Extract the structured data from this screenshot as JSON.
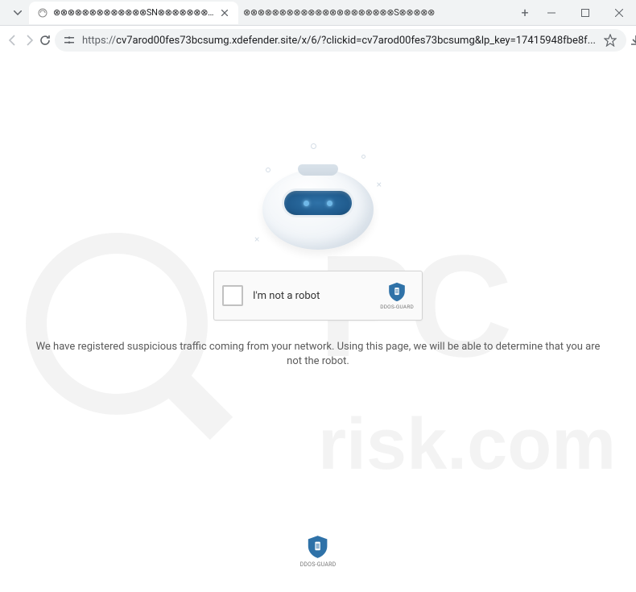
{
  "window": {
    "tab_title": "⊗⊗⊗⊗⊗⊗⊗⊗⊗⊗⊗⊗⊗SN⊗⊗⊗⊗⊗⊗⊗⊗⊗⊗⊗⊗⊗",
    "tab_extra": "⊗⊗⊗⊗⊗⊗⊗⊗⊗⊗⊗⊗⊗⊗⊗⊗⊗⊗⊗⊗⊗S⊗⊗⊗⊗⊗",
    "url_protocol": "https://",
    "url": "cv7arod00fes73bcsumg.xdefender.site/x/6/?clickid=cv7arod00fes73bcsumg&lp_key=17415948fbe8f..."
  },
  "captcha": {
    "label": "I'm not a robot",
    "brand": "DDOS-GUARD"
  },
  "message": "We have registered suspicious traffic coming from your network. Using this page, we will be able to determine that you are not the robot.",
  "footer": {
    "brand": "DDOS-GUARD"
  },
  "watermark_text": "pcrisk.com",
  "colors": {
    "shield_blue": "#2f72a8",
    "text_gray": "#5a5a5a"
  }
}
